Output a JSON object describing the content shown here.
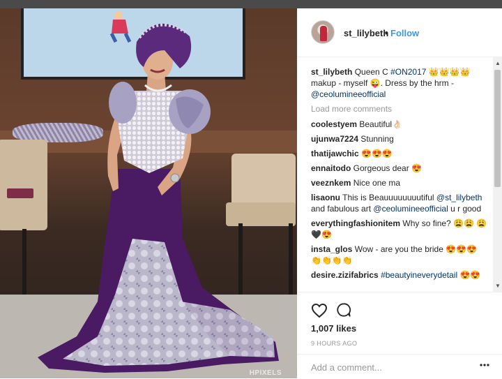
{
  "post": {
    "username": "st_lilybeth",
    "separator": "•",
    "follow_label": "Follow",
    "caption": {
      "username": "st_lilybeth",
      "text_1": "Queen C ",
      "hashtag": "#ON2017",
      "text_2": " 👑👑👑👑 makup - myself 😜. Dress by the hrm - ",
      "mention": "@ceolumineeofficial"
    },
    "load_more_label": "Load more comments",
    "comments": [
      {
        "user": "coolestyem",
        "text": "Beautiful👌🏻"
      },
      {
        "user": "ujunwa7224",
        "text": "Stunning"
      },
      {
        "user": "thatijawchic",
        "text": "😍😍😍"
      },
      {
        "user": "ennaitodo",
        "text": "Gorgeous dear 😍"
      },
      {
        "user": "veeznkem",
        "text": "Nice one ma"
      },
      {
        "user": "lisaonu",
        "text": "This is Beauuuuuuuutiful ",
        "mention": "@st_lilybeth",
        "text_2": " and fabulous art ",
        "mention_2": "@ceolumineeofficial",
        "text_3": " u r good"
      },
      {
        "user": "everythingfashionitem",
        "text": "Why so fine? 😩😩 😩🖤😍"
      },
      {
        "user": "insta_glos",
        "text": "Wow - are you the bride 😍😍😍 👏👏👏👏"
      },
      {
        "user": "desire.zizifabrics",
        "hashtag": "#beautyineverydetail",
        "text": " 😍😍"
      }
    ],
    "likes": "1,007 likes",
    "timestamp": "9 HOURS AGO",
    "comment_placeholder": "Add a comment...",
    "watermark": "HPIXELS"
  },
  "icons": {
    "like": "heart-icon",
    "comment": "comment-bubble-icon",
    "more": "more-options-icon",
    "scroll_up": "▲",
    "scroll_down": "▼"
  },
  "colors": {
    "link": "#3897f0",
    "tag": "#003569",
    "muted": "#999999",
    "dress_purple": "#4a1a63"
  }
}
